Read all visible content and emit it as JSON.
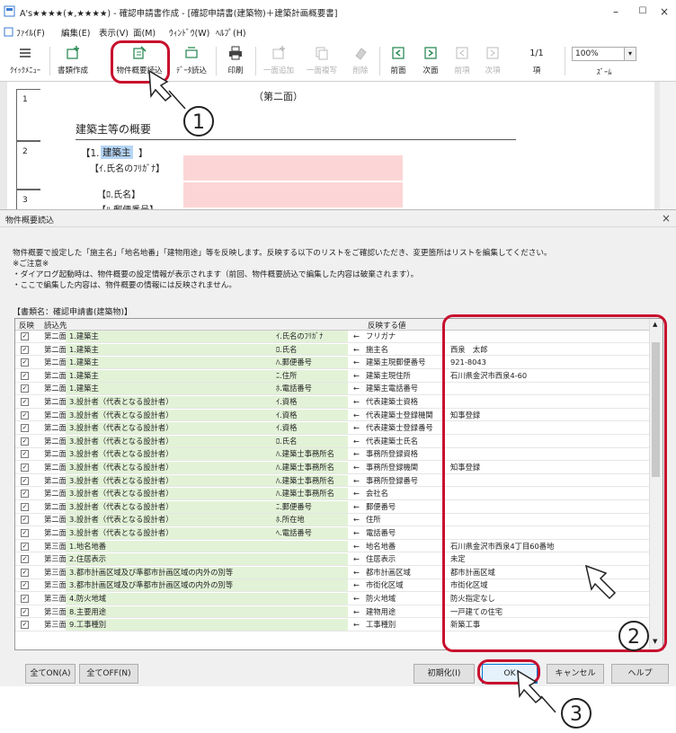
{
  "window": {
    "title": "A's★★★★(★,★★★★) - 確認申請書作成 - [確認申請書(建築物)＋建築計画概要書]",
    "controls": {
      "minimize": "–",
      "maximize": "☐",
      "close": "×"
    }
  },
  "menu": [
    "ﾌｧｲﾙ(F)",
    "編集(E)",
    "表示(V)",
    "面(M)",
    "ｳｨﾝﾄﾞｳ(W)",
    "ﾍﾙﾌﾟ(H)"
  ],
  "toolbar": {
    "quick_menu": "ｸｲｯｸﾒﾆｭｰ",
    "create_docs": "書類作成",
    "read_property": "物件概要読込",
    "read_data": "ﾃﾞｰﾀ読込",
    "print": "印刷",
    "add_page": "一面追加",
    "copy_page": "一面複写",
    "delete": "削除",
    "prev_page": "前面",
    "next_page": "次面",
    "prev_item": "前項",
    "next_item": "次項",
    "item_counter": "1/1",
    "item_label": "項",
    "zoom_value": "100%",
    "zoom_label": "ｽﾞｰﾑ"
  },
  "document": {
    "tabs": [
      "1",
      "2",
      "3"
    ],
    "page_label": "（第二面）",
    "section_title": "建築主等の概要",
    "item1": "【1.",
    "item1_selected": "建築主",
    "item1_close": "】",
    "field_kana": "【ｲ.氏名のﾌﾘｶﾞﾅ】",
    "field_name": "【ﾛ.氏名】",
    "field_zip": "【ﾊ.郵便番号】"
  },
  "dialog": {
    "title": "物件概要読込",
    "close": "×",
    "info_lines": [
      "物件概要で設定した「施主名」「地名地番」「建物用途」等を反映します。反映する以下のリストをご確認いただき、変更箇所はリストを編集してください。",
      "※ご注意※",
      "・ダイアログ起動時は、物件概要の設定情報が表示されます（前回、物件概要読込で編集した内容は破棄されます）。",
      "・ここで編集した内容は、物件概要の情報には反映されません。"
    ],
    "doc_name": "【書類名：確認申請書(建築物)】",
    "headers": {
      "reflect": "反映",
      "target": "読込先",
      "value": "反映する値"
    },
    "rows": [
      {
        "page": "第二面",
        "item": "1.建築主",
        "sub": "ｲ.氏名のﾌﾘｶﾞﾅ",
        "field": "フリガナ",
        "value": ""
      },
      {
        "page": "第二面",
        "item": "1.建築主",
        "sub": "ﾛ.氏名",
        "field": "施主名",
        "value": "西泉　太郎"
      },
      {
        "page": "第二面",
        "item": "1.建築主",
        "sub": "ﾊ.郵便番号",
        "field": "建築主現郵便番号",
        "value": "921-8043"
      },
      {
        "page": "第二面",
        "item": "1.建築主",
        "sub": "ﾆ.住所",
        "field": "建築主現住所",
        "value": "石川県金沢市西泉4-60"
      },
      {
        "page": "第二面",
        "item": "1.建築主",
        "sub": "ﾎ.電話番号",
        "field": "建築主電話番号",
        "value": ""
      },
      {
        "page": "第二面",
        "item": "3.設計者（代表となる設計者）",
        "sub": "ｲ.資格",
        "field": "代表建築士資格",
        "value": ""
      },
      {
        "page": "第二面",
        "item": "3.設計者（代表となる設計者）",
        "sub": "ｲ.資格",
        "field": "代表建築士登録機関",
        "value": "知事登録"
      },
      {
        "page": "第二面",
        "item": "3.設計者（代表となる設計者）",
        "sub": "ｲ.資格",
        "field": "代表建築士登録番号",
        "value": ""
      },
      {
        "page": "第二面",
        "item": "3.設計者（代表となる設計者）",
        "sub": "ﾛ.氏名",
        "field": "代表建築士氏名",
        "value": ""
      },
      {
        "page": "第二面",
        "item": "3.設計者（代表となる設計者）",
        "sub": "ﾊ.建築士事務所名",
        "field": "事務所登録資格",
        "value": ""
      },
      {
        "page": "第二面",
        "item": "3.設計者（代表となる設計者）",
        "sub": "ﾊ.建築士事務所名",
        "field": "事務所登録機関",
        "value": "知事登録"
      },
      {
        "page": "第二面",
        "item": "3.設計者（代表となる設計者）",
        "sub": "ﾊ.建築士事務所名",
        "field": "事務所登録番号",
        "value": ""
      },
      {
        "page": "第二面",
        "item": "3.設計者（代表となる設計者）",
        "sub": "ﾊ.建築士事務所名",
        "field": "会社名",
        "value": ""
      },
      {
        "page": "第二面",
        "item": "3.設計者（代表となる設計者）",
        "sub": "ﾆ.郵便番号",
        "field": "郵便番号",
        "value": ""
      },
      {
        "page": "第二面",
        "item": "3.設計者（代表となる設計者）",
        "sub": "ﾎ.所在地",
        "field": "住所",
        "value": ""
      },
      {
        "page": "第二面",
        "item": "3.設計者（代表となる設計者）",
        "sub": "ﾍ.電話番号",
        "field": "電話番号",
        "value": ""
      },
      {
        "page": "第三面",
        "item": "1.地名地番",
        "sub": "",
        "field": "地名地番",
        "value": "石川県金沢市西泉4丁目60番地"
      },
      {
        "page": "第三面",
        "item": "2.住居表示",
        "sub": "",
        "field": "住居表示",
        "value": "未定"
      },
      {
        "page": "第三面",
        "item": "3.都市計画区域及び準都市計画区域の内外の別等",
        "sub": "",
        "field": "都市計画区域",
        "value": "都市計画区域"
      },
      {
        "page": "第三面",
        "item": "3.都市計画区域及び準都市計画区域の内外の別等",
        "sub": "",
        "field": "市街化区域",
        "value": "市街化区域"
      },
      {
        "page": "第三面",
        "item": "4.防火地域",
        "sub": "",
        "field": "防火地域",
        "value": "防火指定なし"
      },
      {
        "page": "第三面",
        "item": "8.主要用途",
        "sub": "",
        "field": "建物用途",
        "value": "一戸建ての住宅"
      },
      {
        "page": "第三面",
        "item": "9.工事種別",
        "sub": "",
        "field": "工事種別",
        "value": "新築工事"
      }
    ],
    "buttons": {
      "all_on": "全てON(A)",
      "all_off": "全てOFF(N)",
      "reset": "初期化(I)",
      "ok": "OK",
      "cancel": "キャンセル",
      "help": "ヘルプ"
    }
  },
  "annotations": {
    "step1": "1",
    "step2": "2",
    "step3": "3",
    "color": "#c8102e"
  }
}
